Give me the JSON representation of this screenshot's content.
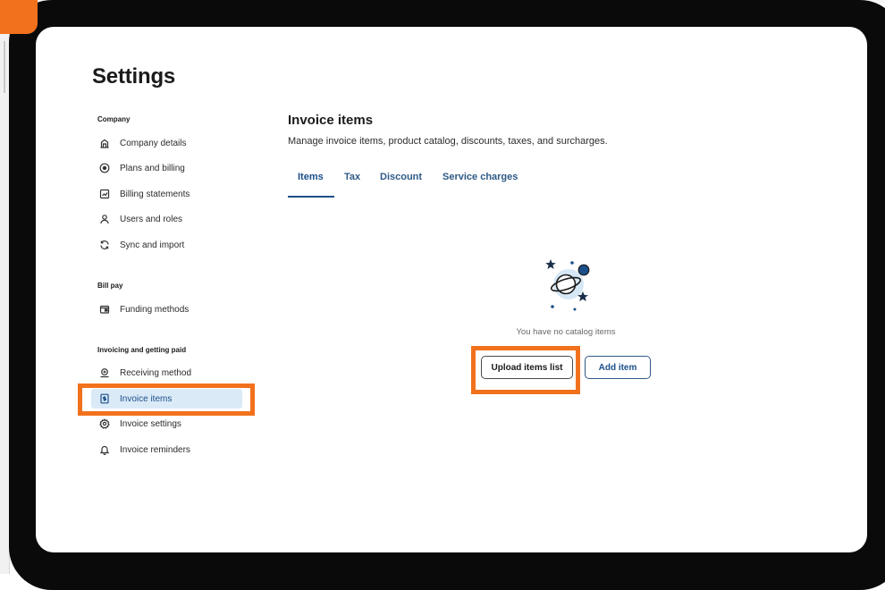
{
  "page": {
    "title": "Settings"
  },
  "sidebar": {
    "sections": [
      {
        "title": "Company",
        "items": [
          {
            "label": "Company details",
            "icon": "building-icon"
          },
          {
            "label": "Plans and billing",
            "icon": "plan-icon"
          },
          {
            "label": "Billing statements",
            "icon": "statement-icon"
          },
          {
            "label": "Users and roles",
            "icon": "user-icon"
          },
          {
            "label": "Sync and import",
            "icon": "sync-icon"
          }
        ]
      },
      {
        "title": "Bill pay",
        "items": [
          {
            "label": "Funding methods",
            "icon": "wallet-icon"
          }
        ]
      },
      {
        "title": "Invoicing and getting paid",
        "items": [
          {
            "label": "Receiving method",
            "icon": "receive-icon"
          },
          {
            "label": "Invoice items",
            "icon": "invoice-icon",
            "active": true
          },
          {
            "label": "Invoice settings",
            "icon": "gear-icon"
          },
          {
            "label": "Invoice reminders",
            "icon": "bell-icon"
          }
        ]
      }
    ]
  },
  "main": {
    "title": "Invoice items",
    "subtitle": "Manage invoice items, product catalog, discounts, taxes, and surcharges.",
    "tabs": [
      {
        "label": "Items",
        "active": true
      },
      {
        "label": "Tax"
      },
      {
        "label": "Discount"
      },
      {
        "label": "Service charges"
      }
    ],
    "empty_state": {
      "icon": "planet-icon",
      "text": "You have no catalog items",
      "upload_label": "Upload items list",
      "add_label": "Add item"
    }
  },
  "colors": {
    "highlight": "#f2711c",
    "accent": "#1b4f8a",
    "active_bg": "#dbeaf7",
    "bezel": "#0a0a0a"
  }
}
